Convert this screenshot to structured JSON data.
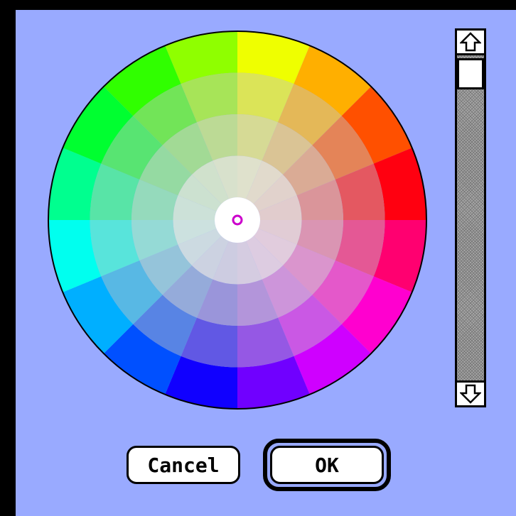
{
  "dialog": {
    "background": "#99aaff",
    "frame_color": "#000000"
  },
  "color_wheel": {
    "rings": 4,
    "sectors": 16,
    "center_color": "#ffffff",
    "selection_marker_color": "#cc00cc"
  },
  "scrollbar": {
    "up_icon": "arrow-up-icon",
    "down_icon": "arrow-down-icon",
    "thumb_position": 0
  },
  "buttons": {
    "cancel_label": "Cancel",
    "ok_label": "OK"
  }
}
